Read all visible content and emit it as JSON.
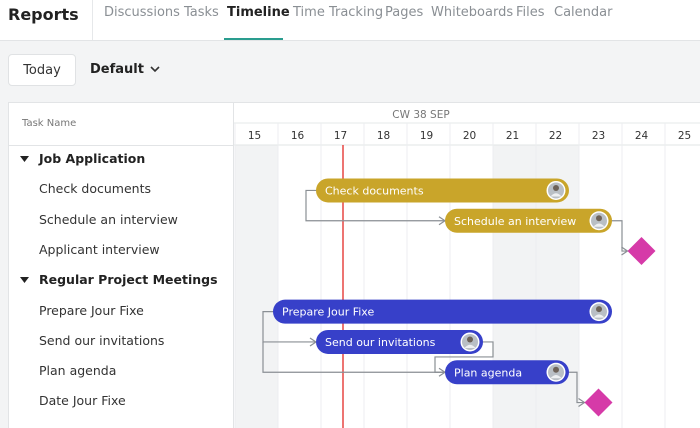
{
  "app": {
    "title": "Reports"
  },
  "nav": {
    "tabs": [
      {
        "label": "Discussions"
      },
      {
        "label": "Tasks"
      },
      {
        "label": "Timeline",
        "active": true
      },
      {
        "label": "Time Tracking"
      },
      {
        "label": "Pages"
      },
      {
        "label": "Whiteboards"
      },
      {
        "label": "Files"
      },
      {
        "label": "Calendar"
      }
    ]
  },
  "toolbar": {
    "today_label": "Today",
    "view_label": "Default",
    "view_icon": "chevron-down-icon"
  },
  "gantt": {
    "task_column_header": "Task Name",
    "week_label": "CW 38 SEP",
    "days": [
      "15",
      "16",
      "17",
      "18",
      "19",
      "20",
      "21",
      "22",
      "23",
      "24",
      "25"
    ],
    "today_day": "17",
    "shaded_days": [
      "15",
      "21",
      "22"
    ],
    "groups": [
      {
        "label": "Job Application",
        "color": "#c9a52a",
        "tasks": [
          {
            "label": "Check documents",
            "bar_label": "Check documents",
            "start": "16",
            "end": "22"
          },
          {
            "label": "Schedule an interview",
            "bar_label": "Schedule an interview",
            "start": "19",
            "end": "23"
          },
          {
            "label": "Applicant interview",
            "milestone": "24"
          }
        ]
      },
      {
        "label": "Regular Project Meetings",
        "color": "#3740c9",
        "tasks": [
          {
            "label": "Prepare Jour Fixe",
            "bar_label": "Prepare Jour Fixe",
            "start": "15",
            "end": "23"
          },
          {
            "label": "Send our invitations",
            "bar_label": "Send our invitations",
            "start": "16",
            "end": "20"
          },
          {
            "label": "Plan agenda",
            "bar_label": "Plan agenda",
            "start": "19",
            "end": "22"
          },
          {
            "label": "Date Jour Fixe",
            "milestone": "23"
          }
        ]
      }
    ],
    "colors": {
      "today_line": "#e53935",
      "milestone": "#d63aa8",
      "connector": "#8a8f94",
      "shade": "#f2f3f4"
    },
    "avatar_icon": "avatar-icon",
    "expand_icon": "caret-down-icon"
  }
}
